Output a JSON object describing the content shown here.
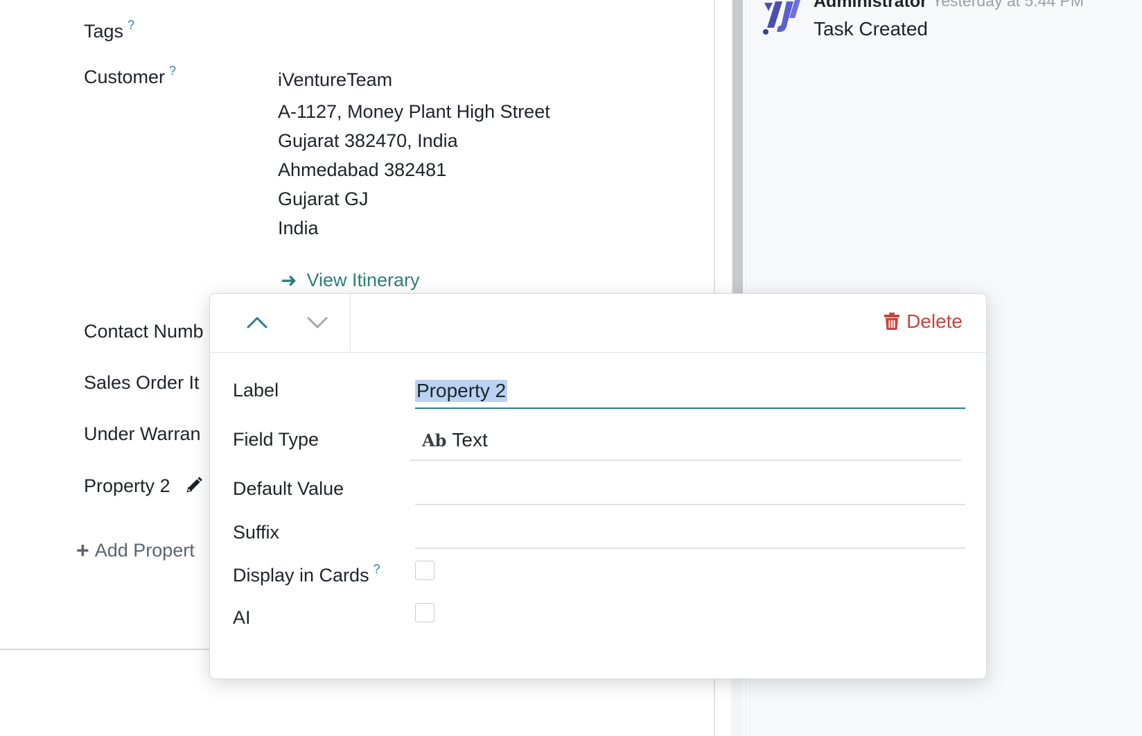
{
  "fields": {
    "tags_label": "Tags",
    "customer_label": "Customer",
    "contact_label": "Contact Numb",
    "sales_order_label": "Sales Order It",
    "under_warranty_label": "Under Warran",
    "property2_label": "Property 2",
    "help_mark": "?"
  },
  "customer": {
    "name": "iVentureTeam",
    "address_lines": [
      "A-1127, Money Plant High Street",
      "Gujarat 382470, India",
      "Ahmedabad 382481",
      "Gujarat GJ",
      "India"
    ],
    "view_itinerary": "View Itinerary",
    "arrow": "➜"
  },
  "add_property": {
    "plus": "+",
    "label": "Add Propert"
  },
  "activity": {
    "user": "Administrator",
    "time": "Yesterday at 5:44 PM",
    "text": "Task Created"
  },
  "popup": {
    "delete_label": "Delete",
    "rows": {
      "label": "Label",
      "field_type": "Field Type",
      "default_value": "Default Value",
      "suffix": "Suffix",
      "display_in_cards": "Display in Cards",
      "ai": "AI"
    },
    "label_value": "Property 2",
    "field_type_icon": "Ab",
    "field_type_value": "Text",
    "help_mark": "?"
  },
  "colors": {
    "accent": "#2b7f80",
    "delete": "#c8453b",
    "help": "#2f7fbf",
    "selection": "#b9d2f2"
  },
  "icons": {
    "up": "chevron-up-icon",
    "down": "chevron-down-icon",
    "trash": "trash-icon",
    "pencil": "pencil-icon",
    "logo": "app-logo-icon"
  }
}
